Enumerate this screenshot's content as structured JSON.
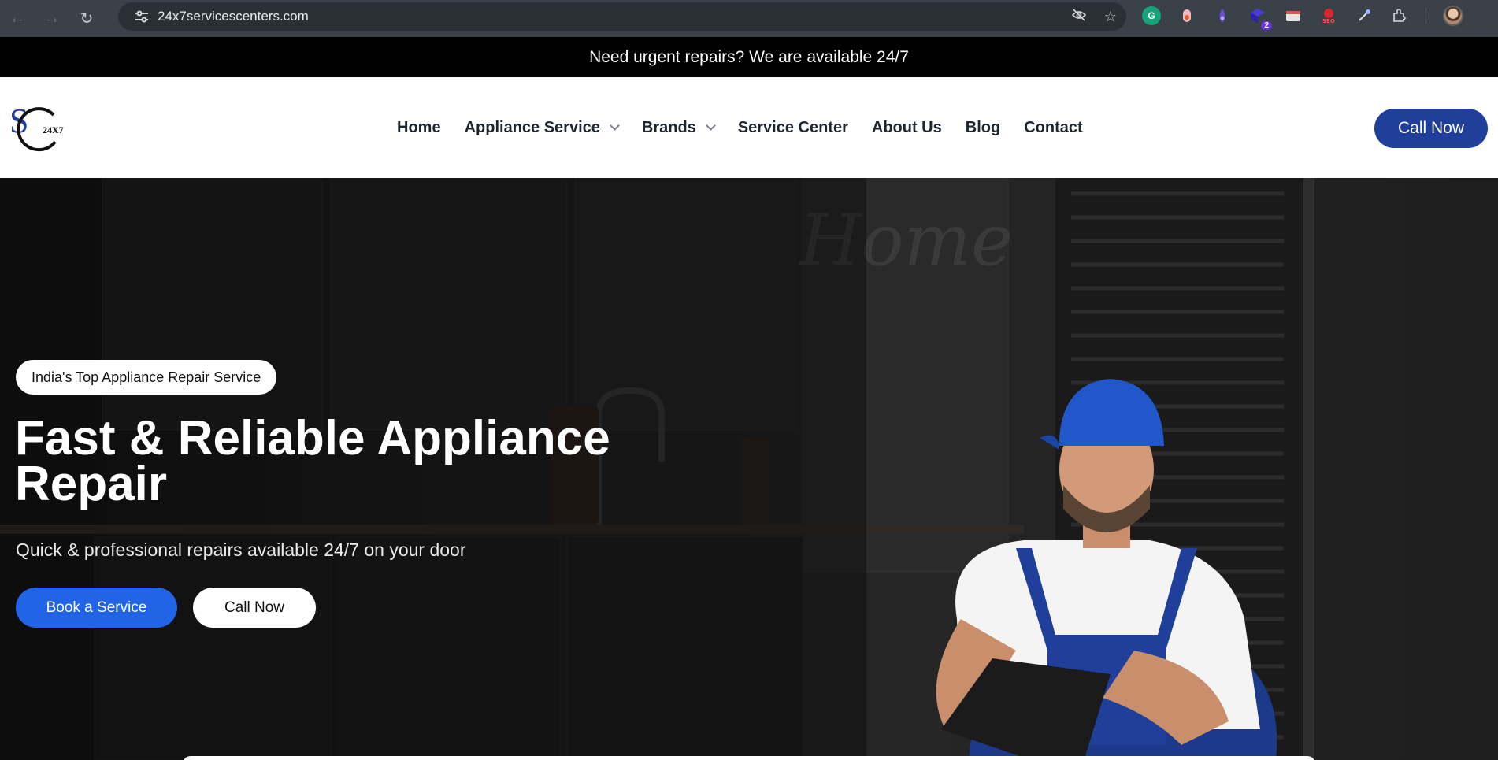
{
  "browser": {
    "url": "24x7servicescenters.com",
    "extension_badge": "2",
    "extensions": [
      "grammarly-icon",
      "extension-pink-icon",
      "extension-drop-icon",
      "extension-hex-icon",
      "extension-card-icon",
      "seo-icon",
      "eyedropper-icon",
      "puzzle-icon"
    ]
  },
  "announcement": "Need urgent repairs? We are available 24/7",
  "header": {
    "logo_text": "24X7",
    "nav": [
      {
        "label": "Home",
        "dropdown": false
      },
      {
        "label": "Appliance Service",
        "dropdown": true
      },
      {
        "label": "Brands",
        "dropdown": true
      },
      {
        "label": "Service Center",
        "dropdown": false
      },
      {
        "label": "About Us",
        "dropdown": false
      },
      {
        "label": "Blog",
        "dropdown": false
      },
      {
        "label": "Contact",
        "dropdown": false
      }
    ],
    "cta": "Call Now"
  },
  "hero": {
    "badge": "India's Top Appliance Repair Service",
    "title_line1": "Fast & Reliable Appliance",
    "title_line2": "Repair",
    "subtitle": "Quick & professional repairs available 24/7 on your door",
    "primary_button": "Book a Service",
    "secondary_button": "Call Now",
    "wall_text": "Home"
  },
  "colors": {
    "accent_dark_blue": "#1f3f9a",
    "accent_blue": "#2264e8",
    "topbar": "#000000"
  }
}
